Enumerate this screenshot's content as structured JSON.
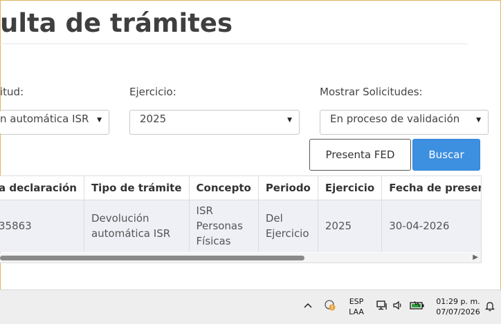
{
  "page": {
    "title": "ulta de trámites"
  },
  "filters": {
    "solicitud": {
      "label": "itud:",
      "value": "n automática ISR"
    },
    "ejercicio": {
      "label": "Ejercicio:",
      "value": "2025"
    },
    "mostrar": {
      "label": "Mostrar Solicitudes:",
      "value": "En proceso de validación"
    }
  },
  "actions": {
    "presenta_label": "Presenta FED",
    "buscar_label": "Buscar"
  },
  "table": {
    "headers": [
      "a declaración",
      "Tipo de trámite",
      "Concepto",
      "Periodo",
      "Ejercicio",
      "Fecha de presentación"
    ],
    "rows": [
      {
        "declaracion": "35863",
        "tipo": "Devolución automática ISR",
        "concepto": "ISR Personas Físicas",
        "periodo": "Del Ejercicio",
        "ejercicio": "2025",
        "fecha": "30-04-2026"
      }
    ],
    "scroll_fraction": 0.65
  },
  "taskbar": {
    "lang_top": "ESP",
    "lang_bottom": "LAA",
    "time": "01:29 p. m.",
    "date": "07/07/2026",
    "icons": [
      "chevron-up-icon",
      "shield-warning-icon",
      "network-icon",
      "volume-icon",
      "battery-icon",
      "notification-icon"
    ]
  },
  "colors": {
    "accent": "#3d8fe0",
    "frame": "#e2b35a",
    "row_bg": "#eef0f5"
  }
}
